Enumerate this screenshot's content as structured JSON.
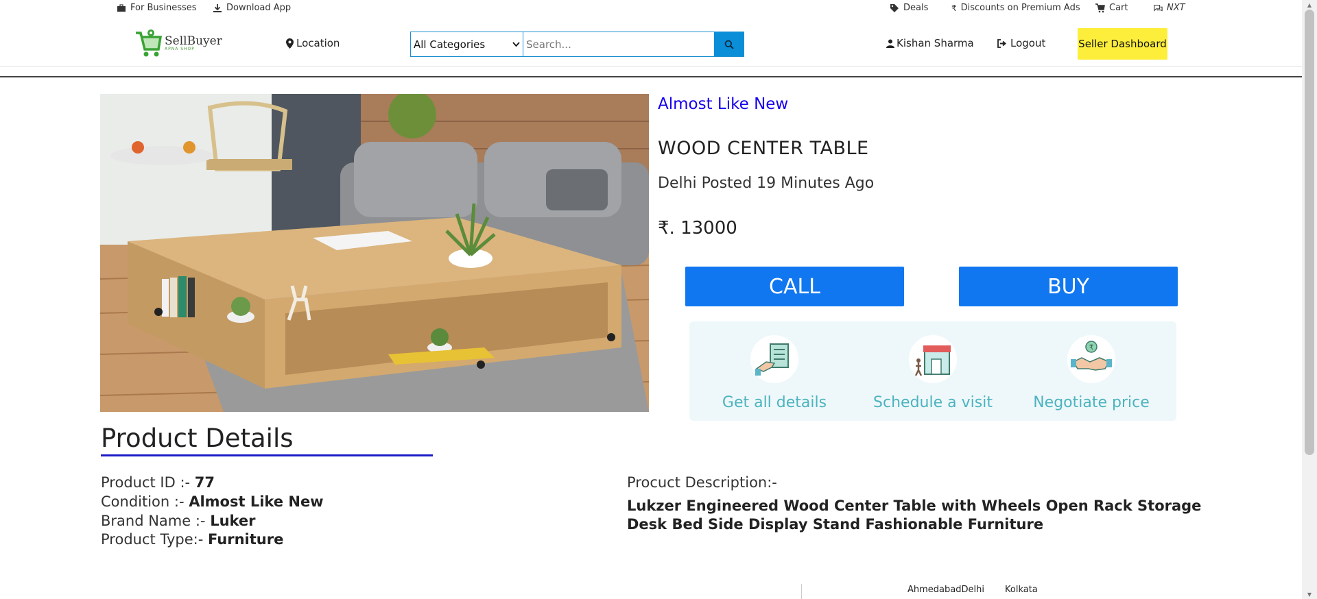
{
  "topbar": {
    "for_businesses": "For Businesses",
    "download_app": "Download App",
    "deals": "Deals",
    "discounts": "Discounts on Premium Ads",
    "cart": "Cart",
    "chat": "NXT"
  },
  "header": {
    "logo_text": "SellBuyer",
    "logo_subtext": "APNA SHOP",
    "location": "Location",
    "category_selected": "All Categories",
    "search_placeholder": "Search...",
    "user_name": "Kishan Sharma",
    "logout": "Logout",
    "seller_dashboard": "Seller Dashboard"
  },
  "product": {
    "condition": "Almost Like New",
    "title": "WOOD CENTER TABLE",
    "meta": "Delhi Posted 19 Minutes Ago",
    "price": "₹. 13000",
    "call_label": "CALL",
    "buy_label": "BUY"
  },
  "features": [
    {
      "label": "Get all details",
      "icon": "document-hand-icon"
    },
    {
      "label": "Schedule a visit",
      "icon": "shop-visit-icon"
    },
    {
      "label": "Negotiate price",
      "icon": "handshake-rupee-icon"
    }
  ],
  "details": {
    "heading": "Product Details",
    "id_label": "Product ID :- ",
    "id_value": "77",
    "condition_label": "Condition :- ",
    "condition_value": "Almost Like New",
    "brand_label": "Brand Name :- ",
    "brand_value": "Luker",
    "type_label": "Product Type:- ",
    "type_value": "Furniture",
    "description_label": "Procuct Description:-",
    "description_text": "Lukzer Engineered Wood Center Table with Wheels Open Rack Storage Desk Bed Side Display Stand Fashionable Furniture"
  },
  "footer": {
    "cities_1": "AhmedabadDelhi",
    "cities_2": "Kolkata"
  },
  "colors": {
    "accent_blue": "#1177f0",
    "seller_yellow": "#fdee3b",
    "condition_blue": "#1400ee",
    "feature_teal": "#4cb3bf"
  }
}
